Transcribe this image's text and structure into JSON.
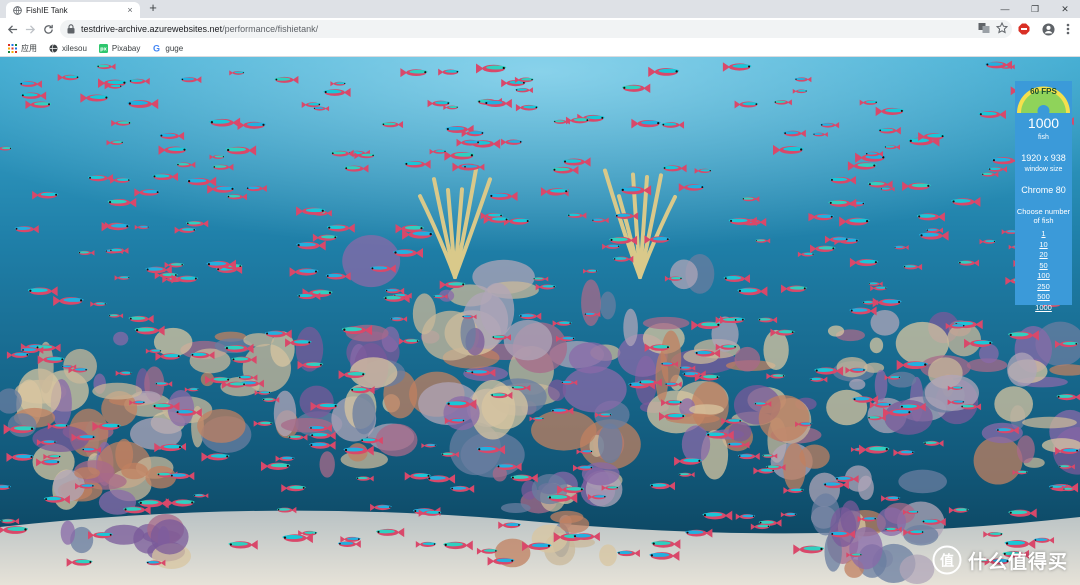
{
  "tab": {
    "title": "FishIE Tank",
    "close": "×"
  },
  "new_tab_label": "+",
  "window_controls": {
    "minimize": "—",
    "maximize": "❐",
    "close": "✕"
  },
  "address": {
    "host": "testdrive-archive.azurewebsites.net",
    "path": "/performance/fishietank/"
  },
  "bookmarks": [
    {
      "label": "应用",
      "icon": "apps-grid-icon"
    },
    {
      "label": "xilesou",
      "icon": "globe-icon"
    },
    {
      "label": "Pixabay",
      "icon": "pixabay-icon"
    },
    {
      "label": "guge",
      "icon": "google-icon"
    }
  ],
  "panel": {
    "fps": "60 FPS",
    "fish_count": "1000",
    "fish_label": "fish",
    "resolution": "1920 x 938",
    "resolution_label": "window size",
    "browser": "Chrome 80",
    "choose_label": "Choose number of fish",
    "options": [
      "1",
      "10",
      "20",
      "50",
      "100",
      "250",
      "500",
      "1000"
    ]
  },
  "watermark": {
    "text": "什么值得买",
    "badge": "值"
  },
  "colors": {
    "panel": "#3b9ad9",
    "water_top": "#2a8fb8",
    "water_bottom": "#0d4b6e",
    "sand": "#c8c4b8"
  }
}
